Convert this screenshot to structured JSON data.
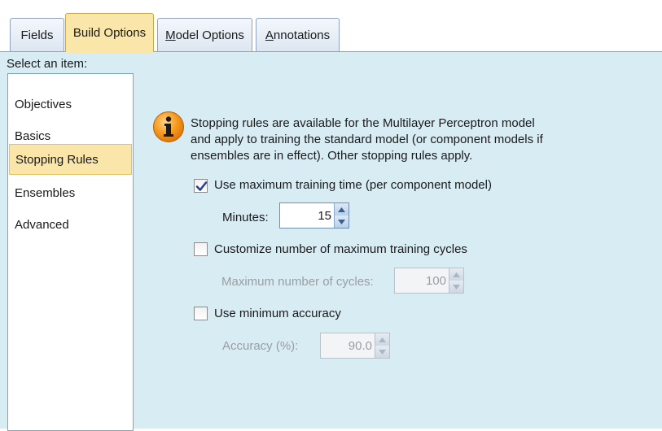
{
  "tabs": [
    {
      "label_pre": "",
      "mnemonic": "",
      "label_post": "Fields",
      "active": false
    },
    {
      "label_pre": "Build Options",
      "mnemonic": "",
      "label_post": "",
      "active": true
    },
    {
      "label_pre": "",
      "mnemonic": "M",
      "label_post": "odel Options",
      "active": false
    },
    {
      "label_pre": "",
      "mnemonic": "A",
      "label_post": "nnotations",
      "active": false
    }
  ],
  "sidebar": {
    "select_label": "Select an item:",
    "items": [
      {
        "label": "Objectives"
      },
      {
        "label": "Basics"
      },
      {
        "label": "Stopping Rules",
        "selected": true
      },
      {
        "label": "Ensembles"
      },
      {
        "label": "Advanced"
      }
    ]
  },
  "info": {
    "icon": "info-icon",
    "lines": [
      "Stopping rules are available for the Multilayer Perceptron model",
      "and apply to training the standard model (or component models if",
      "ensembles are in effect).  Other stopping rules apply."
    ]
  },
  "options": {
    "max_time": {
      "label": "Use maximum training time (per component model)",
      "checked": true,
      "field_label": "Minutes:",
      "value": "15"
    },
    "max_cycles": {
      "label": "Customize number of maximum training cycles",
      "checked": false,
      "field_label": "Maximum number of cycles:",
      "value": "100"
    },
    "min_accuracy": {
      "label": "Use minimum accuracy",
      "checked": false,
      "field_label": "Accuracy (%):",
      "value": "90.0"
    }
  },
  "colors": {
    "accent": "#f9e6a8",
    "panel": "#d8ecf4",
    "info_orange": "#f08a10"
  }
}
